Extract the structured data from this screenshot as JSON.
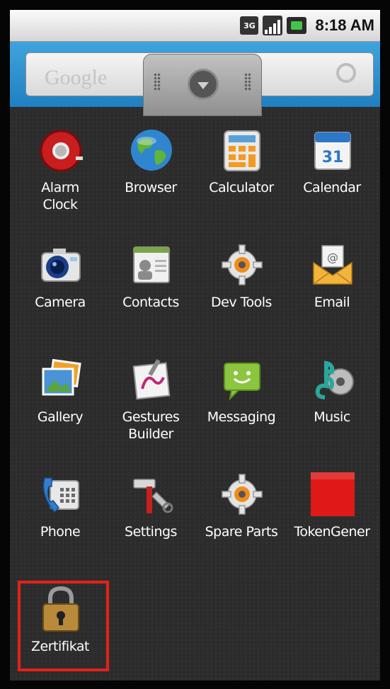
{
  "status_bar": {
    "network": "3G",
    "time": "8:18 AM"
  },
  "home": {
    "search_placeholder": "Google"
  },
  "apps": [
    {
      "label": "Alarm\nClock",
      "icon": "alarm-clock-icon"
    },
    {
      "label": "Browser",
      "icon": "browser-globe-icon"
    },
    {
      "label": "Calculator",
      "icon": "calculator-icon"
    },
    {
      "label": "Calendar",
      "icon": "calendar-icon"
    },
    {
      "label": "Camera",
      "icon": "camera-icon"
    },
    {
      "label": "Contacts",
      "icon": "contacts-icon"
    },
    {
      "label": "Dev Tools",
      "icon": "dev-tools-gear-icon"
    },
    {
      "label": "Email",
      "icon": "email-envelope-icon"
    },
    {
      "label": "Gallery",
      "icon": "gallery-icon"
    },
    {
      "label": "Gestures\nBuilder",
      "icon": "gestures-builder-icon"
    },
    {
      "label": "Messaging",
      "icon": "messaging-icon"
    },
    {
      "label": "Music",
      "icon": "music-icon"
    },
    {
      "label": "Phone",
      "icon": "phone-icon"
    },
    {
      "label": "Settings",
      "icon": "settings-tools-icon"
    },
    {
      "label": "Spare Parts",
      "icon": "spare-parts-gear-icon"
    },
    {
      "label": "TokenGener",
      "icon": "token-generator-icon"
    },
    {
      "label": "Zertifikat",
      "icon": "padlock-icon"
    }
  ],
  "calendar_day": "31",
  "highlight_color": "#e52119"
}
